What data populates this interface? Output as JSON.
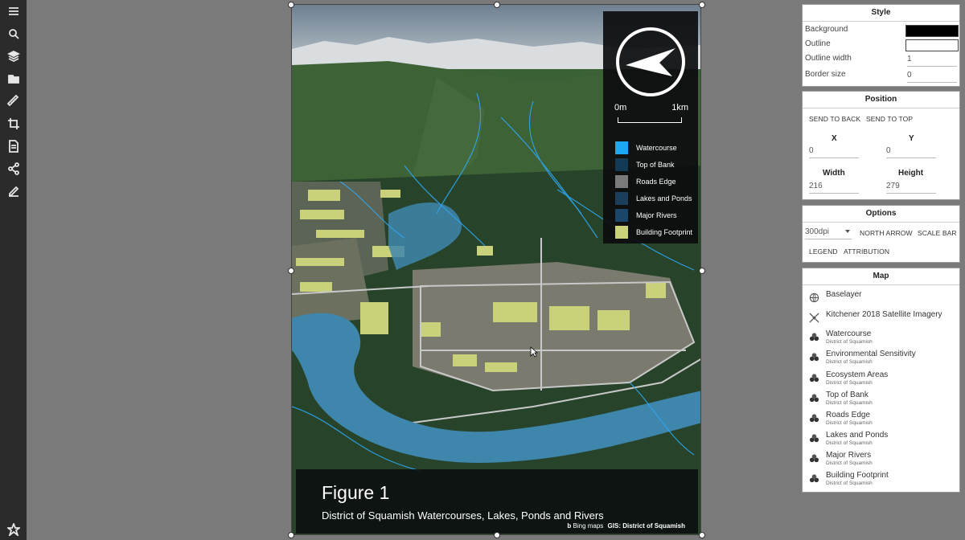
{
  "toolbar": {
    "icons": [
      "menu-icon",
      "search-icon",
      "layers-icon",
      "folder-icon",
      "ruler-icon",
      "crop-icon",
      "print-icon",
      "share-icon",
      "edit-icon",
      "pin-icon"
    ]
  },
  "legend": {
    "scale_start": "0m",
    "scale_end": "1km",
    "items": [
      {
        "label": "Watercourse",
        "color": "#1ea7f5"
      },
      {
        "label": "Top of Bank",
        "color": "#123a55"
      },
      {
        "label": "Roads Edge",
        "color": "#7a7a7a"
      },
      {
        "label": "Lakes and Ponds",
        "color": "#1b3f5a"
      },
      {
        "label": "Major Rivers",
        "color": "#1a466a"
      },
      {
        "label": "Building Footprint",
        "color": "#c9d27a"
      }
    ]
  },
  "caption": {
    "title": "Figure 1",
    "subtitle": "District of Squamish Watercourses, Lakes, Ponds and Rivers",
    "bing": "Bing maps",
    "gis": "GIS: District of Squamish"
  },
  "style_panel": {
    "title": "Style",
    "background_label": "Background",
    "background_color": "#000000",
    "outline_label": "Outline",
    "outline_color": "#ffffff",
    "outline_width_label": "Outline width",
    "outline_width_value": "1",
    "border_size_label": "Border size",
    "border_size_value": "0"
  },
  "position_panel": {
    "title": "Position",
    "send_back": "SEND TO BACK",
    "send_top": "SEND TO TOP",
    "x_label": "X",
    "x_value": "0",
    "y_label": "Y",
    "y_value": "0",
    "width_label": "Width",
    "width_value": "216",
    "height_label": "Height",
    "height_value": "279"
  },
  "options_panel": {
    "title": "Options",
    "dpi": "300dpi",
    "north_arrow": "NORTH ARROW",
    "scale_bar": "SCALE BAR",
    "legend": "LEGEND",
    "attribution": "ATTRIBUTION"
  },
  "map_panel": {
    "title": "Map",
    "layers": [
      {
        "name": "Baselayer",
        "sub": "",
        "icon": "globe-icon"
      },
      {
        "name": "Kitchener 2018 Satellite Imagery",
        "sub": "",
        "icon": "satellite-icon"
      },
      {
        "name": "Watercourse",
        "sub": "District of Squamish",
        "icon": "layer-stack-icon"
      },
      {
        "name": "Environmental Sensitivity",
        "sub": "District of Squamish",
        "icon": "layer-stack-icon"
      },
      {
        "name": "Ecosystem Areas",
        "sub": "District of Squamish",
        "icon": "layer-stack-icon"
      },
      {
        "name": "Top of Bank",
        "sub": "District of Squamish",
        "icon": "layer-stack-icon"
      },
      {
        "name": "Roads Edge",
        "sub": "District of Squamish",
        "icon": "layer-stack-icon"
      },
      {
        "name": "Lakes and Ponds",
        "sub": "District of Squamish",
        "icon": "layer-stack-icon"
      },
      {
        "name": "Major Rivers",
        "sub": "District of Squamish",
        "icon": "layer-stack-icon"
      },
      {
        "name": "Building Footprint",
        "sub": "District of Squamish",
        "icon": "layer-stack-icon"
      }
    ]
  }
}
